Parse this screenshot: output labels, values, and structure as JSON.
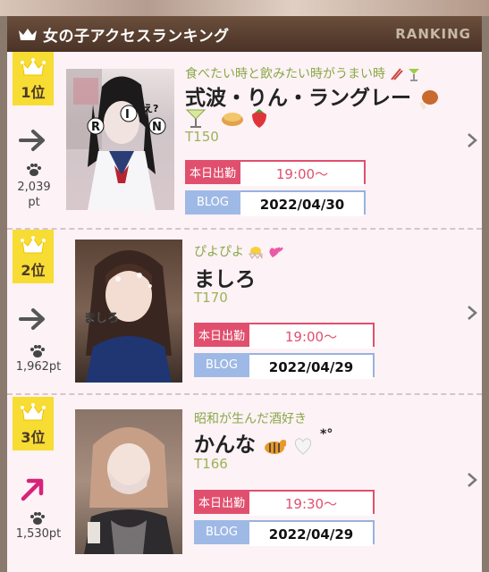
{
  "header": {
    "title": "女の子アクセスランキング",
    "badge": "RANKING"
  },
  "colors": {
    "header_bg": "#4a3326",
    "crown": "#f7dc33",
    "work_red": "#e0506e",
    "blog_blue": "#98b2e0",
    "catch_green": "#8aa84a"
  },
  "entries": [
    {
      "rank": "1位",
      "trend": "same",
      "points": "2,039\npt",
      "points_top": "2,039",
      "points_bottom": "pt",
      "catchphrase": "食べたい時と飲みたい時がうまい時",
      "name": "式波・りん・ラングレー",
      "height": "T150",
      "work_label": "本日出勤",
      "work_time": "19:00〜",
      "blog_label": "BLOG",
      "blog_date": "2022/04/30",
      "photo_text": [
        "R",
        "I",
        "N"
      ],
      "photo_text2": "え?"
    },
    {
      "rank": "2位",
      "trend": "same",
      "points": "1,962pt",
      "catchphrase": "ぴよぴよ",
      "name": "ましろ",
      "height": "T170",
      "work_label": "本日出勤",
      "work_time": "19:00〜",
      "blog_label": "BLOG",
      "blog_date": "2022/04/29",
      "photo_text": "ましろ"
    },
    {
      "rank": "3位",
      "trend": "up",
      "points": "1,530pt",
      "catchphrase": "昭和が生んだ酒好き",
      "name": "かんな",
      "height": "T166",
      "work_label": "本日出勤",
      "work_time": "19:30〜",
      "blog_label": "BLOG",
      "blog_date": "2022/04/29"
    }
  ]
}
